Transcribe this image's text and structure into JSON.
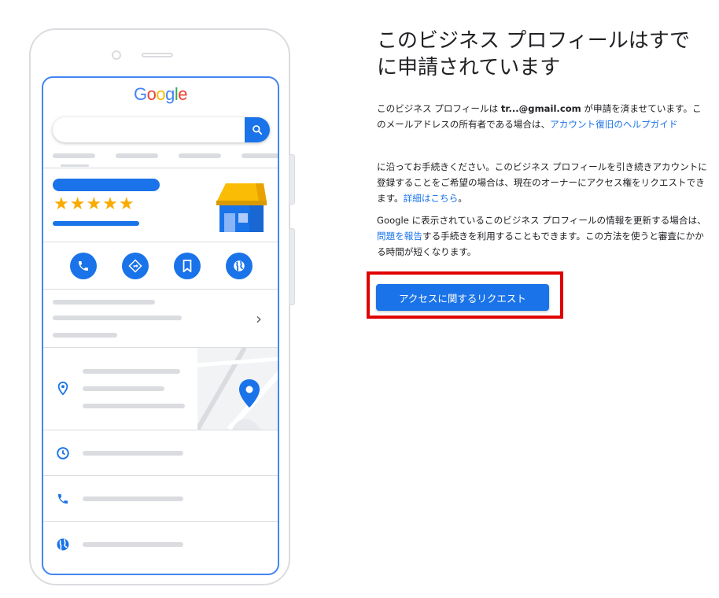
{
  "heading": "このビジネス プロフィールはすでに申請されています",
  "paragraph1": {
    "t1": "このビジネス プロフィールは ",
    "email": "tr...@gmail.com",
    "t2": " が申請を済ませています。このメールアドレスの所有者である場合は、",
    "link": "アカウント復旧のヘルプガイド"
  },
  "paragraph2": {
    "t1": "に沿ってお手続きください。このビジネス プロフィールを引き続きアカウントに登録することをご希望の場合は、現在のオーナーにアクセス権をリクエストできます。",
    "link": "詳細はこちら",
    "t2": "。"
  },
  "paragraph3": {
    "t1": "Google に表示されているこのビジネス プロフィールの情報を更新する場合は、",
    "link": "問題を報告",
    "t2": "する手続きを利用することもできます。この方法を使うと審査にかかる時間が短くなります。"
  },
  "request_button": "アクセスに関するリクエスト",
  "phone": {
    "logo": [
      "G",
      "o",
      "o",
      "g",
      "l",
      "e"
    ],
    "stars": "★★★★★",
    "chevron": "›",
    "action_icons": [
      "phone-icon",
      "directions-icon",
      "bookmark-icon",
      "website-icon"
    ],
    "row_icons": [
      "location-pin-icon",
      "clock-icon",
      "phone-icon",
      "globe-icon"
    ]
  },
  "colors": {
    "accent": "#1a73e8",
    "highlight": "#e00000",
    "google_blue": "#4285f4",
    "google_red": "#ea4335",
    "google_yellow": "#fbbc05",
    "google_green": "#34a853",
    "star": "#f9ab00"
  }
}
